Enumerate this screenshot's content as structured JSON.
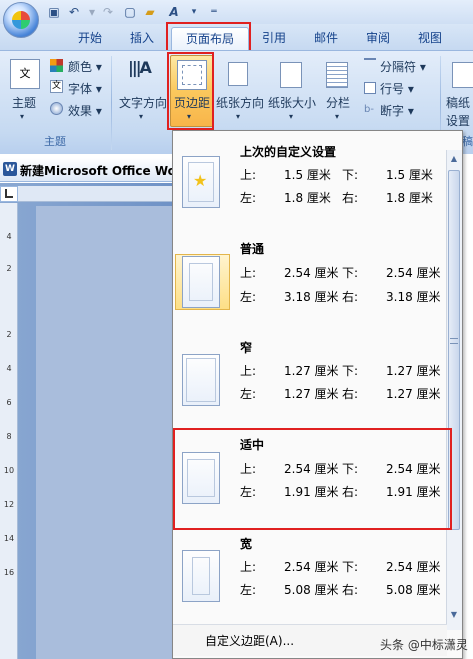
{
  "tabs": [
    "开始",
    "插入",
    "页面布局",
    "引用",
    "邮件",
    "审阅",
    "视图"
  ],
  "ribbon": {
    "theme_group": {
      "label": "主题",
      "theme_btn": "主题",
      "colors": "颜色",
      "fonts": "字体",
      "effects": "效果",
      "icon_glyph_wen": "文"
    },
    "page_setup": {
      "text_direction": "文字方向",
      "margins": "页边距",
      "orientation": "纸张方向",
      "size": "纸张大小",
      "columns": "分栏",
      "breaks": "分隔符",
      "line_numbers": "行号",
      "hyphenation": "断字"
    },
    "right_group": {
      "label_top": "稿纸",
      "label_bottom": "设置"
    },
    "group_label_right_partial": "稿"
  },
  "document": {
    "title": "新建Microsoft Office Wo"
  },
  "ruler_numbers": [
    "4",
    "2",
    "2",
    "4",
    "6",
    "8",
    "10",
    "12",
    "14",
    "16"
  ],
  "dropdown": {
    "options": [
      {
        "name": "上次的自定义设置",
        "top_label": "上:",
        "top": "1.5 厘米",
        "bottom_label": "下:",
        "bottom": "1.5 厘米",
        "left_label": "左:",
        "left": "1.8 厘米",
        "right_label": "右:",
        "right": "1.8 厘米"
      },
      {
        "name": "普通",
        "top_label": "上:",
        "top": "2.54 厘米",
        "bottom_label": "下:",
        "bottom": "2.54 厘米",
        "left_label": "左:",
        "left": "3.18 厘米",
        "right_label": "右:",
        "right": "3.18 厘米"
      },
      {
        "name": "窄",
        "top_label": "上:",
        "top": "1.27 厘米",
        "bottom_label": "下:",
        "bottom": "1.27 厘米",
        "left_label": "左:",
        "left": "1.27 厘米",
        "right_label": "右:",
        "right": "1.27 厘米"
      },
      {
        "name": "适中",
        "top_label": "上:",
        "top": "2.54 厘米",
        "bottom_label": "下:",
        "bottom": "2.54 厘米",
        "left_label": "左:",
        "left": "1.91 厘米",
        "right_label": "右:",
        "right": "1.91 厘米"
      },
      {
        "name": "宽",
        "top_label": "上:",
        "top": "2.54 厘米",
        "bottom_label": "下:",
        "bottom": "2.54 厘米",
        "left_label": "左:",
        "left": "5.08 厘米",
        "right_label": "右:",
        "right": "5.08 厘米"
      }
    ],
    "custom": "自定义边距(A)..."
  },
  "watermark": "头条 @中标潇灵",
  "colors": {
    "highlight_outline": "#e02020",
    "selected_bg": "#fddf86",
    "ribbon_bg": "#c5d9f1"
  }
}
